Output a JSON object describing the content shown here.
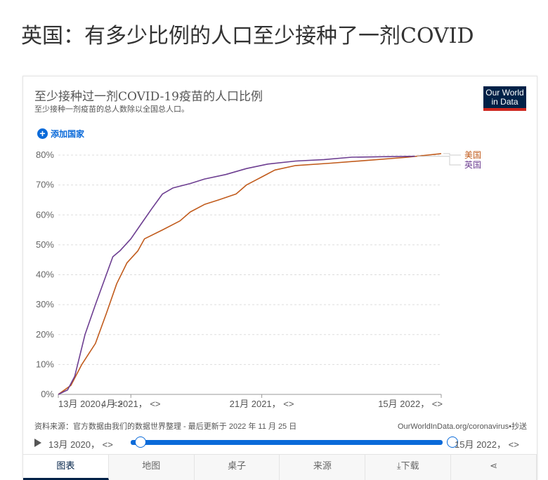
{
  "page_title": "英国：有多少比例的人口至少接种了一剂COVID",
  "card": {
    "title": "至少接种过一剂COVID-19疫苗的人口比例",
    "subtitle": "至少接种一剂疫苗的总人数除以全国总人口。",
    "logo": "Our World in Data",
    "add_country": "添加国家",
    "source": "资料来源：官方数据由我们的数据世界整理 - 最后更新于 2022 年 11 月 25 日",
    "source_right": "OurWorldInData.org/coronavirus•抄送",
    "timeline": {
      "start": "13月 2020， <>",
      "end": "15月 2022， <>",
      "start_fraction": 0,
      "end_fraction": 1
    },
    "tabs": [
      {
        "label": "图表",
        "active": true
      },
      {
        "label": "地图"
      },
      {
        "label": "桌子"
      },
      {
        "label": "来源"
      },
      {
        "label": "下载",
        "icon": "download-icon"
      },
      {
        "label": "",
        "icon": "share-icon"
      }
    ]
  },
  "chart_data": {
    "type": "line",
    "ylim": [
      0,
      80
    ],
    "y_ticks": [
      "0%",
      "10%",
      "20%",
      "30%",
      "40%",
      "50%",
      "60%",
      "70%",
      "80%"
    ],
    "x_range": [
      "2020-12-13",
      "2022-11-15"
    ],
    "x_ticks": [
      {
        "date": "2020-12-13",
        "label": "13月 2020， <>"
      },
      {
        "date": "2021-04-25",
        "label": "4月 2021， <>"
      },
      {
        "date": "2021-12-21",
        "label": "21月 2021， <>"
      },
      {
        "date": "2022-11-15",
        "label": "15月 2022， <>"
      }
    ],
    "grid": true,
    "legend": "right-end labels",
    "series": [
      {
        "name": "美国",
        "color": "#c15b1c",
        "points": [
          [
            "2020-12-13",
            0
          ],
          [
            "2021-01-05",
            3
          ],
          [
            "2021-01-25",
            10
          ],
          [
            "2021-02-19",
            17
          ],
          [
            "2021-03-11",
            27
          ],
          [
            "2021-03-30",
            37
          ],
          [
            "2021-04-18",
            44
          ],
          [
            "2021-05-08",
            48
          ],
          [
            "2021-05-20",
            52
          ],
          [
            "2021-06-22",
            55
          ],
          [
            "2021-07-24",
            58
          ],
          [
            "2021-08-12",
            61
          ],
          [
            "2021-09-07",
            63.5
          ],
          [
            "2021-10-03",
            65
          ],
          [
            "2021-11-04",
            67
          ],
          [
            "2021-11-23",
            70
          ],
          [
            "2021-12-19",
            72.5
          ],
          [
            "2022-01-14",
            75
          ],
          [
            "2022-02-21",
            76.5
          ],
          [
            "2022-04-27",
            77.3
          ],
          [
            "2022-06-30",
            78.2
          ],
          [
            "2022-09-15",
            79.3
          ],
          [
            "2022-11-15",
            80.5
          ]
        ]
      },
      {
        "name": "英国",
        "color": "#6d3e91",
        "points": [
          [
            "2020-12-13",
            0
          ],
          [
            "2020-12-30",
            1.5
          ],
          [
            "2021-01-12",
            6
          ],
          [
            "2021-01-31",
            20
          ],
          [
            "2021-02-19",
            30
          ],
          [
            "2021-03-11",
            40
          ],
          [
            "2021-03-23",
            46
          ],
          [
            "2021-04-05",
            48
          ],
          [
            "2021-04-25",
            52
          ],
          [
            "2021-05-14",
            57
          ],
          [
            "2021-06-02",
            62
          ],
          [
            "2021-06-22",
            67
          ],
          [
            "2021-07-11",
            69
          ],
          [
            "2021-08-12",
            70.5
          ],
          [
            "2021-09-07",
            72
          ],
          [
            "2021-10-16",
            73.5
          ],
          [
            "2021-11-23",
            75.5
          ],
          [
            "2022-01-01",
            77
          ],
          [
            "2022-02-21",
            78
          ],
          [
            "2022-04-14",
            78.5
          ],
          [
            "2022-06-04",
            79.3
          ],
          [
            "2022-08-21",
            79.5
          ],
          [
            "2022-09-28",
            79.6
          ]
        ]
      }
    ]
  }
}
